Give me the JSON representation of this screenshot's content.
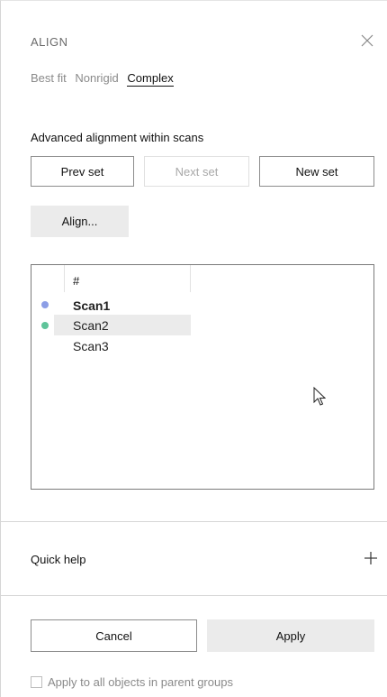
{
  "panel": {
    "title": "ALIGN",
    "close_icon": "close-icon"
  },
  "tabs": [
    {
      "label": "Best fit",
      "active": false
    },
    {
      "label": "Nonrigid",
      "active": false
    },
    {
      "label": "Complex",
      "active": true
    }
  ],
  "complex": {
    "subtitle": "Advanced alignment within scans",
    "prev_set_label": "Prev set",
    "next_set_label": "Next set",
    "new_set_label": "New set",
    "align_label": "Align..."
  },
  "list": {
    "header": "#",
    "rows": [
      {
        "label": "Scan1",
        "dot_color": "#8c9ee6",
        "bold": true,
        "selected": false
      },
      {
        "label": "Scan2",
        "dot_color": "#5fc49a",
        "bold": false,
        "selected": true
      },
      {
        "label": "Scan3",
        "dot_color": null,
        "bold": false,
        "selected": false
      }
    ]
  },
  "quick_help": {
    "label": "Quick help",
    "expand_icon": "plus-icon"
  },
  "footer": {
    "cancel_label": "Cancel",
    "apply_label": "Apply",
    "checkbox_label": "Apply to all objects in parent groups",
    "checkbox_checked": false
  }
}
